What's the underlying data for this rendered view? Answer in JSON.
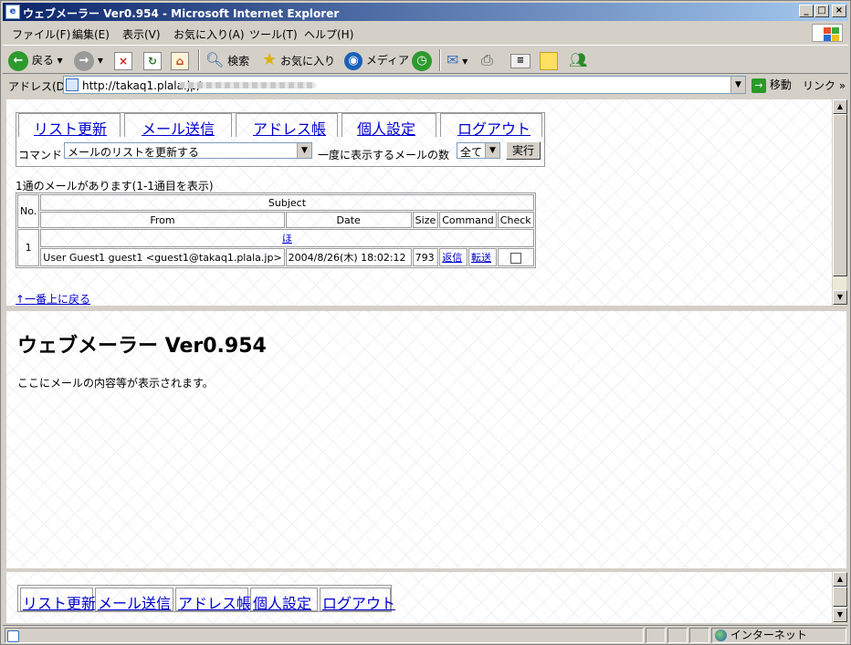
{
  "window": {
    "title": "ウェブメーラー Ver0.954 - Microsoft Internet Explorer"
  },
  "menu": [
    "ファイル(F)",
    "編集(E)",
    "表示(V)",
    "お気に入り(A)",
    "ツール(T)",
    "ヘルプ(H)"
  ],
  "toolbar": {
    "back_label": "戻る",
    "search_label": "検索",
    "favorites_label": "お気に入り",
    "media_label": "メディア"
  },
  "address": {
    "label": "アドレス(D)",
    "url": "http://takaq1.plala.jp/",
    "go_label": "移動",
    "links_label": "リンク »"
  },
  "nav": {
    "items": [
      "リスト更新",
      "メール送信",
      "アドレス帳",
      "個人設定",
      "ログアウト"
    ],
    "command_label": "コマンド",
    "command_value": "メールのリストを更新する",
    "per_page_label": "一度に表示するメールの数",
    "per_page_value": "全て",
    "execute_label": "実行"
  },
  "mail_list": {
    "summary": "1通のメールがあります(1-1通目を表示)",
    "headers": {
      "no": "No.",
      "subject": "Subject",
      "from": "From",
      "date": "Date",
      "size": "Size",
      "command": "Command",
      "check": "Check"
    },
    "rows": [
      {
        "no": "1",
        "subject": "ほ",
        "from": "User Guest1 guest1 <guest1@takaq1.plala.jp>",
        "date": "2004/8/26(木) 18:02:12",
        "size": "793",
        "reply": "返信",
        "forward": "転送",
        "checked": false
      }
    ],
    "to_top": "↑一番上に戻る"
  },
  "viewer": {
    "title": "ウェブメーラー Ver0.954",
    "message": "ここにメールの内容等が表示されます。"
  },
  "status": {
    "zone": "インターネット"
  }
}
